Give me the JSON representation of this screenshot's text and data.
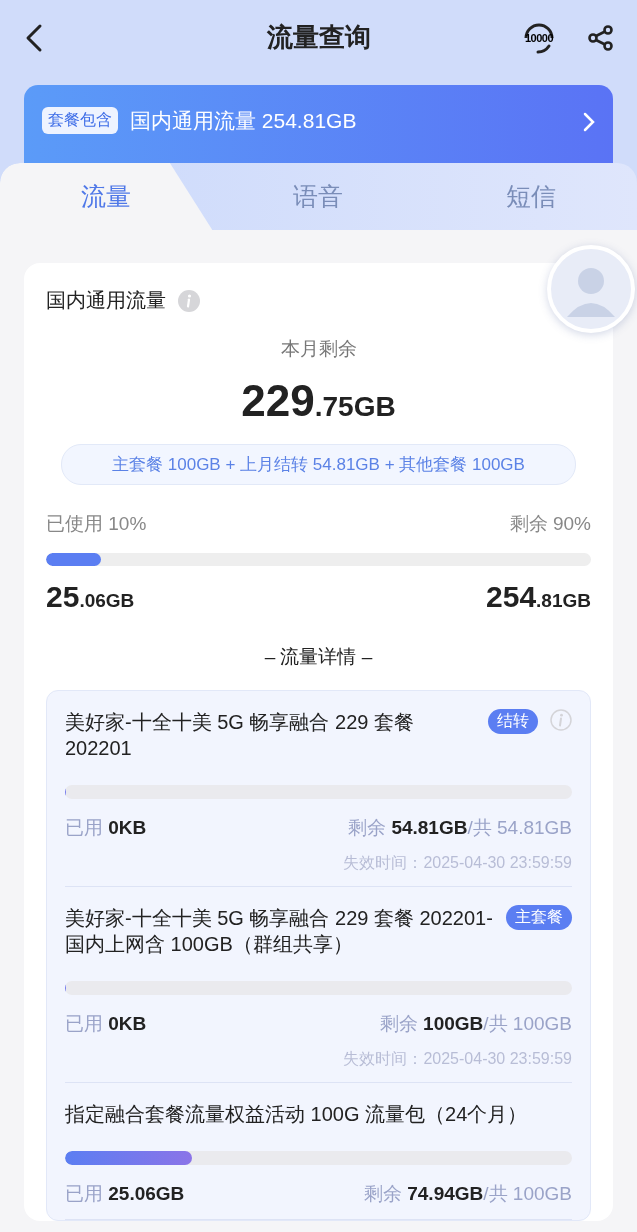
{
  "header": {
    "title": "流量查询",
    "hotline": "10000"
  },
  "banner": {
    "tag": "套餐包含",
    "text": "国内通用流量 254.81GB"
  },
  "tabs": [
    {
      "label": "流量",
      "selected": true
    },
    {
      "label": "语音",
      "selected": false
    },
    {
      "label": "短信",
      "selected": false
    }
  ],
  "summary": {
    "title": "国内通用流量",
    "remaining_label": "本月剩余",
    "remaining_int": "229",
    "remaining_dec": ".75GB",
    "breakdown": "主套餐 100GB + 上月结转 54.81GB + 其他套餐 100GB",
    "used_label": "已使用 10%",
    "left_label": "剩余 90%",
    "level": 0.1,
    "used_int": "25",
    "used_dec": ".06GB",
    "total_int": "254",
    "total_dec": ".81GB"
  },
  "details_heading": "– 流量详情 –",
  "plans": [
    {
      "title": "美好家-十全十美 5G 畅享融合 229 套餐 202201",
      "tag": "结转",
      "info": true,
      "level": 0,
      "used": "已用 **0KB**",
      "remaining": "剩余 **54.81GB**/共 54.81GB",
      "expiry": "失效时间：2025-04-30 23:59:59"
    },
    {
      "title": "美好家-十全十美 5G 畅享融合 229 套餐 202201-国内上网含 100GB（群组共享）",
      "tag": "主套餐",
      "info": false,
      "level": 0,
      "used": "已用 **0KB**",
      "remaining": "剩余 **100GB**/共 100GB",
      "expiry": "失效时间：2025-04-30 23:59:59"
    },
    {
      "title": "指定融合套餐流量权益活动 100G 流量包（24个月）",
      "info": false,
      "level": 0.25,
      "used": "已用 **25.06GB**",
      "remaining": "剩余 **74.94GB**/共 100GB"
    }
  ]
}
